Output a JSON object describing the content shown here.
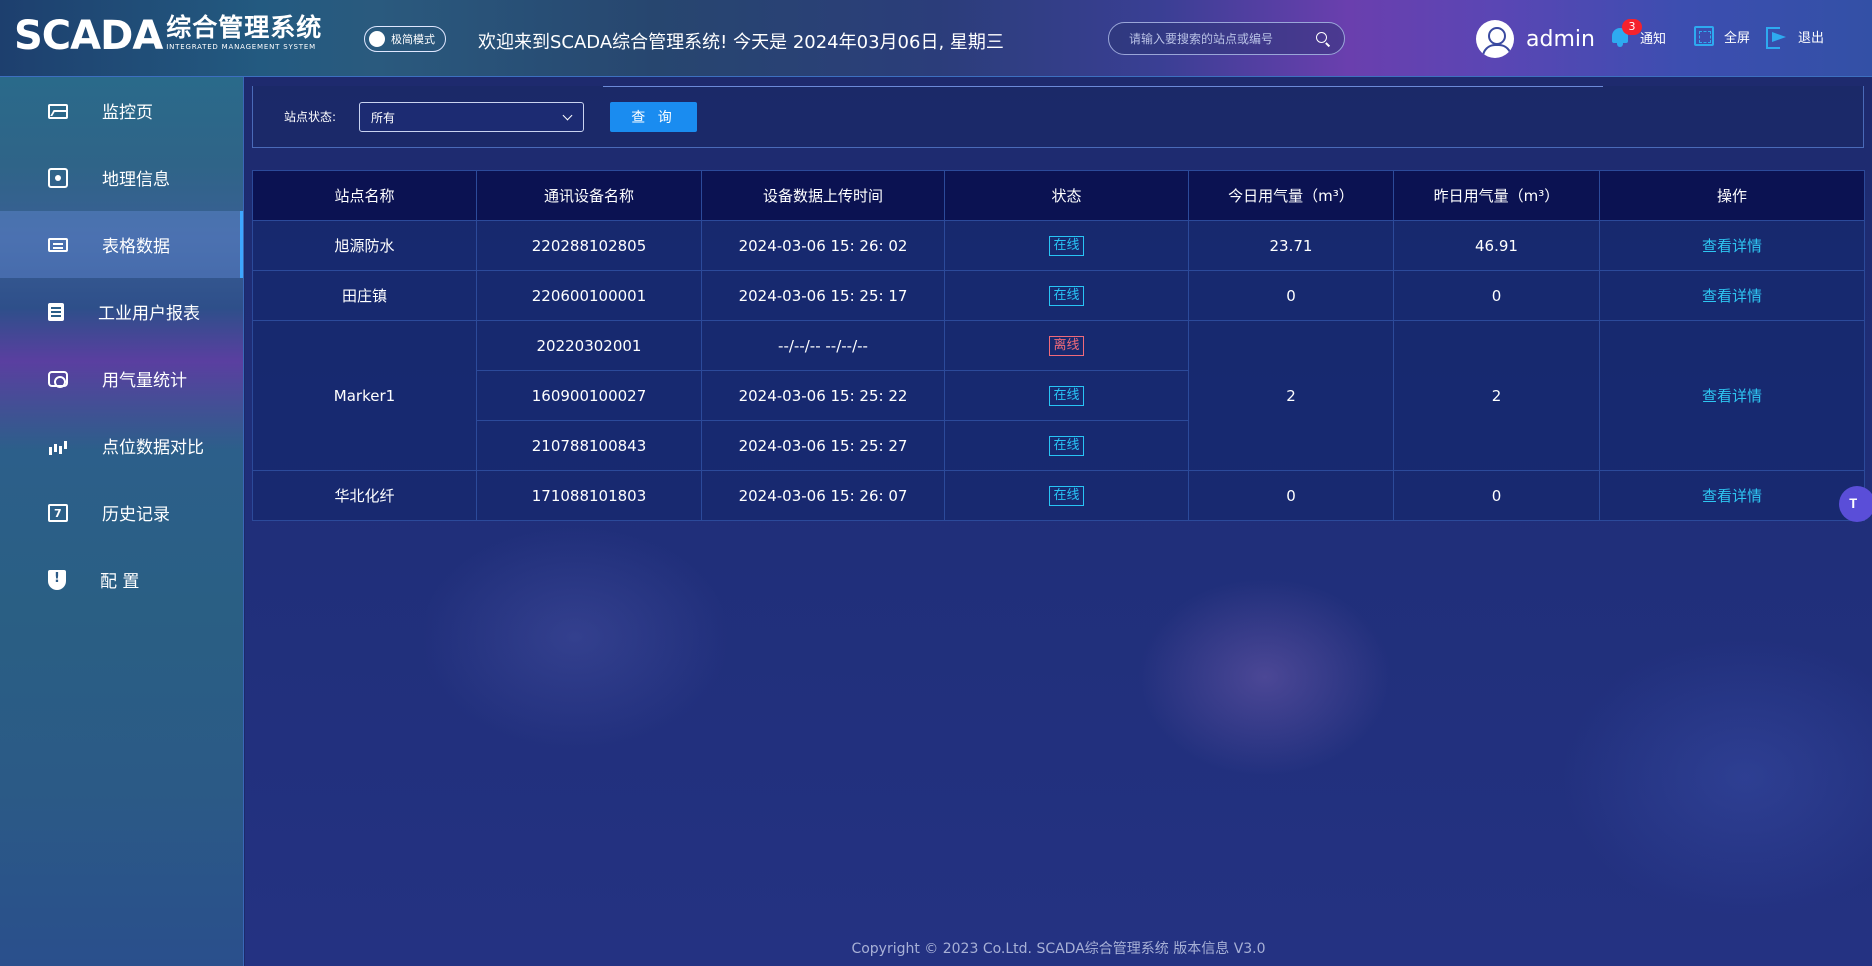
{
  "header": {
    "logo_text": "SCADA",
    "logo_cn": "综合管理系统",
    "logo_en": "INTEGRATED MANAGEMENT SYSTEM",
    "mode_label": "极简模式",
    "welcome": "欢迎来到SCADA综合管理系统!   今天是 2024年03月06日, 星期三",
    "search_placeholder": "请输入要搜索的站点或编号",
    "username": "admin",
    "notify_count": "3",
    "notify_label": "通知",
    "fullscreen_label": "全屏",
    "logout_label": "退出"
  },
  "sidebar": {
    "items": [
      {
        "label": "监控页",
        "icon": "monitor-icon"
      },
      {
        "label": "地理信息",
        "icon": "geo-icon"
      },
      {
        "label": "表格数据",
        "icon": "table-icon",
        "active": true
      },
      {
        "label": "工业用户报表",
        "icon": "report-icon"
      },
      {
        "label": "用气量统计",
        "icon": "gas-stat-icon"
      },
      {
        "label": "点位数据对比",
        "icon": "chart-icon"
      },
      {
        "label": "历史记录",
        "icon": "calendar-icon"
      },
      {
        "label": "配 置",
        "icon": "shield-icon"
      }
    ]
  },
  "filter": {
    "label": "站点状态:",
    "selected": "所有",
    "query_label": "查 询"
  },
  "table": {
    "headers": [
      "站点名称",
      "通讯设备名称",
      "设备数据上传时间",
      "状态",
      "今日用气量（m³）",
      "昨日用气量（m³）",
      "操作"
    ],
    "rows": [
      {
        "station": "旭源防水",
        "device": "220288102805",
        "time": "2024-03-06 15: 26: 02",
        "status": "在线",
        "today": "23.71",
        "yesterday": "46.91",
        "action": "查看详情"
      },
      {
        "station": "田庄镇",
        "device": "220600100001",
        "time": "2024-03-06 15: 25: 17",
        "status": "在线",
        "today": "0",
        "yesterday": "0",
        "action": "查看详情"
      },
      {
        "station": "Marker1",
        "devices": [
          {
            "device": "20220302001",
            "time": "--/--/-- --/--/--",
            "status": "离线"
          },
          {
            "device": "160900100027",
            "time": "2024-03-06 15: 25: 22",
            "status": "在线"
          },
          {
            "device": "210788100843",
            "time": "2024-03-06 15: 25: 27",
            "status": "在线"
          }
        ],
        "today": "2",
        "yesterday": "2",
        "action": "查看详情"
      },
      {
        "station": "华北化纤",
        "device": "171088101803",
        "time": "2024-03-06 15: 26: 07",
        "status": "在线",
        "today": "0",
        "yesterday": "0",
        "action": "查看详情"
      }
    ]
  },
  "footer": "Copyright © 2023 Co.Ltd. SCADA综合管理系统 版本信息 V3.0",
  "colors": {
    "online": "#28c4f5",
    "offline": "#f06a7a",
    "primary": "#1a8cf0"
  }
}
